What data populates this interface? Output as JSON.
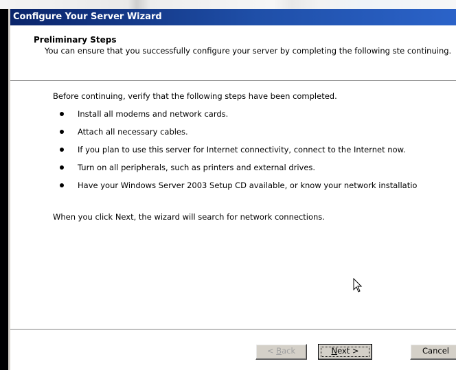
{
  "window": {
    "title": "Configure Your Server Wizard"
  },
  "header": {
    "title": "Preliminary Steps",
    "description": "You can ensure that you successfully configure your server by completing the following ste continuing."
  },
  "content": {
    "intro": "Before continuing, verify that the following steps have been completed.",
    "steps": [
      "Install all modems and network cards.",
      "Attach all necessary cables.",
      "If you plan to use this server for Internet connectivity, connect to the Internet now.",
      "Turn on all peripherals, such as printers and external drives.",
      "Have your Windows Server 2003 Setup CD available, or know your network installatio"
    ],
    "outro": "When you click Next, the wizard will search for network connections."
  },
  "buttons": {
    "back": {
      "prefix": "< ",
      "mnemonic": "B",
      "rest": "ack",
      "enabled": false
    },
    "next": {
      "mnemonic": "N",
      "rest": "ext >"
    },
    "cancel": "Cancel"
  },
  "colors": {
    "title_bar_start": "#0a246a",
    "title_bar_end": "#2b63c9",
    "button_face": "#d4d0c8",
    "disabled_text": "#a0a0a0"
  },
  "icons": {
    "bullet": "bullet-dot",
    "cursor": "mouse-pointer-arrow"
  }
}
